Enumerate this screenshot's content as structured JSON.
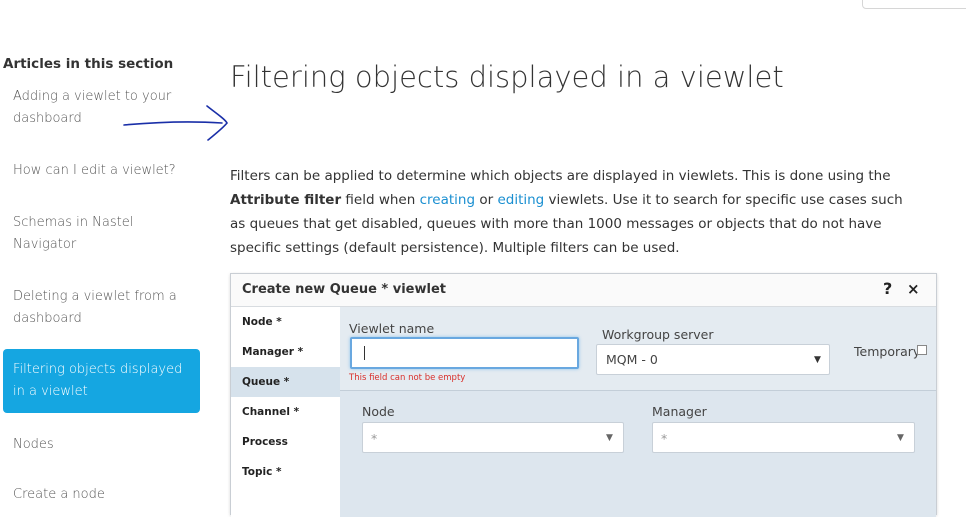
{
  "sidebar": {
    "heading": "Articles in this section",
    "items": [
      {
        "label": "Adding a viewlet to your dashboard"
      },
      {
        "label": "How can I edit a viewlet?"
      },
      {
        "label": "Schemas in Nastel Navigator"
      },
      {
        "label": "Deleting a viewlet from a dashboard"
      },
      {
        "label": "Filtering objects displayed in a viewlet",
        "active": true
      },
      {
        "label": "Nodes"
      },
      {
        "label": "Create a node"
      }
    ]
  },
  "article": {
    "title": "Filtering objects displayed in a viewlet",
    "intro": {
      "part1": "Filters can be applied to determine which objects are displayed in viewlets. This is done using the ",
      "bold": "Attribute filter",
      "part2": " field when ",
      "link1": "creating",
      "part3": " or ",
      "link2": "editing",
      "part4": " viewlets. Use it to search for specific use cases such as queues that get disabled, queues with more than 1000 messages or objects that do not have specific settings (default persistence).  Multiple filters can be used."
    }
  },
  "dialog": {
    "title": "Create new Queue * viewlet",
    "help": "?",
    "close": "×",
    "nav": [
      "Node *",
      "Manager *",
      "Queue *",
      "Channel *",
      "Process",
      "Topic *"
    ],
    "active_nav": "Queue *",
    "viewlet_name_label": "Viewlet name",
    "viewlet_name_value": "",
    "viewlet_name_error": "This field can not be empty",
    "workgroup_label": "Workgroup server",
    "workgroup_value": "MQM - 0",
    "temporary_label": "Temporary",
    "node_label": "Node",
    "node_value": "*",
    "manager_label": "Manager",
    "manager_value": "*"
  },
  "colors": {
    "active_sidebar": "#15a6e1",
    "link": "#1a8fd1",
    "error": "#d9302c",
    "arrow_annotation": "#1a2fa8"
  },
  "icons": [
    "arrow-annotation-icon",
    "help-icon",
    "close-icon",
    "dropdown-arrow-icon",
    "checkbox-icon"
  ]
}
